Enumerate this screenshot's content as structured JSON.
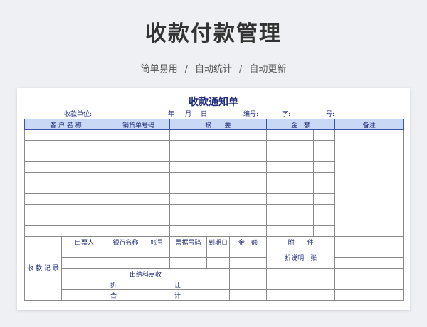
{
  "banner": {
    "title": "收款付款管理",
    "tags": [
      "简单易用",
      "自动统计",
      "自动更新"
    ],
    "separator": "/"
  },
  "form": {
    "title": "收款通知单",
    "meta": {
      "unit_label": "收款单位:",
      "year": "年",
      "month": "月",
      "day": "日",
      "number_label": "编号:",
      "word_label": "字:",
      "no_label": "号:"
    },
    "columns": [
      "客 户 名 称",
      "销货单号码",
      "摘　　要",
      "金　额",
      "备注"
    ],
    "record": {
      "side_label": "收 款 记 录",
      "headers": [
        "出票人",
        "银行名称",
        "帐号",
        "票据号码",
        "到期日",
        "金　额"
      ],
      "attach_label": "附　　件",
      "attach_note": "折说明　张",
      "cashier_label": "出纳科点收",
      "discount_label": "折　　　　　　　　　让",
      "total_label": "合　　　　　　　　　计"
    }
  }
}
